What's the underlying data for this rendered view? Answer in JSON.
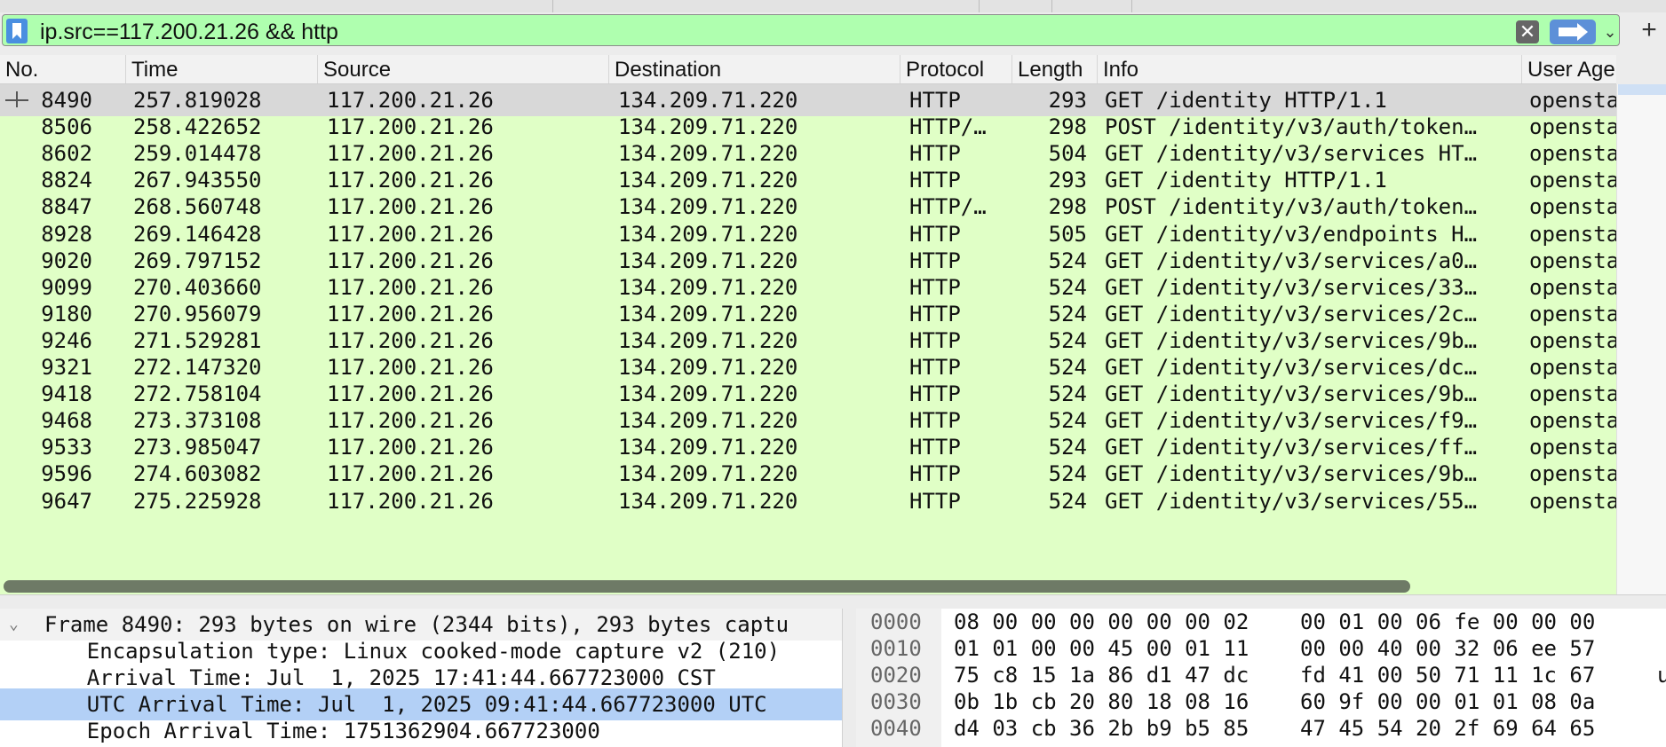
{
  "filter": {
    "value": "ip.src==117.200.21.26 && http",
    "clear_glyph": "✕",
    "dropdown_glyph": "⌄",
    "add_glyph": "+"
  },
  "columns": {
    "no": "No.",
    "time": "Time",
    "source": "Source",
    "destination": "Destination",
    "protocol": "Protocol",
    "length": "Length",
    "info": "Info",
    "user_agent": "User Age"
  },
  "packets": [
    {
      "no": "8490",
      "time": "257.819028",
      "src": "117.200.21.26",
      "dst": "134.209.71.220",
      "proto": "HTTP",
      "len": "293",
      "info": "GET /identity HTTP/1.1",
      "ua": "opensta"
    },
    {
      "no": "8506",
      "time": "258.422652",
      "src": "117.200.21.26",
      "dst": "134.209.71.220",
      "proto": "HTTP/…",
      "len": "298",
      "info": "POST /identity/v3/auth/token…",
      "ua": "opensta"
    },
    {
      "no": "8602",
      "time": "259.014478",
      "src": "117.200.21.26",
      "dst": "134.209.71.220",
      "proto": "HTTP",
      "len": "504",
      "info": "GET /identity/v3/services HT…",
      "ua": "opensta"
    },
    {
      "no": "8824",
      "time": "267.943550",
      "src": "117.200.21.26",
      "dst": "134.209.71.220",
      "proto": "HTTP",
      "len": "293",
      "info": "GET /identity HTTP/1.1",
      "ua": "opensta"
    },
    {
      "no": "8847",
      "time": "268.560748",
      "src": "117.200.21.26",
      "dst": "134.209.71.220",
      "proto": "HTTP/…",
      "len": "298",
      "info": "POST /identity/v3/auth/token…",
      "ua": "opensta"
    },
    {
      "no": "8928",
      "time": "269.146428",
      "src": "117.200.21.26",
      "dst": "134.209.71.220",
      "proto": "HTTP",
      "len": "505",
      "info": "GET /identity/v3/endpoints H…",
      "ua": "opensta"
    },
    {
      "no": "9020",
      "time": "269.797152",
      "src": "117.200.21.26",
      "dst": "134.209.71.220",
      "proto": "HTTP",
      "len": "524",
      "info": "GET /identity/v3/services/a0…",
      "ua": "opensta"
    },
    {
      "no": "9099",
      "time": "270.403660",
      "src": "117.200.21.26",
      "dst": "134.209.71.220",
      "proto": "HTTP",
      "len": "524",
      "info": "GET /identity/v3/services/33…",
      "ua": "opensta"
    },
    {
      "no": "9180",
      "time": "270.956079",
      "src": "117.200.21.26",
      "dst": "134.209.71.220",
      "proto": "HTTP",
      "len": "524",
      "info": "GET /identity/v3/services/2c…",
      "ua": "opensta"
    },
    {
      "no": "9246",
      "time": "271.529281",
      "src": "117.200.21.26",
      "dst": "134.209.71.220",
      "proto": "HTTP",
      "len": "524",
      "info": "GET /identity/v3/services/9b…",
      "ua": "opensta"
    },
    {
      "no": "9321",
      "time": "272.147320",
      "src": "117.200.21.26",
      "dst": "134.209.71.220",
      "proto": "HTTP",
      "len": "524",
      "info": "GET /identity/v3/services/dc…",
      "ua": "opensta"
    },
    {
      "no": "9418",
      "time": "272.758104",
      "src": "117.200.21.26",
      "dst": "134.209.71.220",
      "proto": "HTTP",
      "len": "524",
      "info": "GET /identity/v3/services/9b…",
      "ua": "opensta"
    },
    {
      "no": "9468",
      "time": "273.373108",
      "src": "117.200.21.26",
      "dst": "134.209.71.220",
      "proto": "HTTP",
      "len": "524",
      "info": "GET /identity/v3/services/f9…",
      "ua": "opensta"
    },
    {
      "no": "9533",
      "time": "273.985047",
      "src": "117.200.21.26",
      "dst": "134.209.71.220",
      "proto": "HTTP",
      "len": "524",
      "info": "GET /identity/v3/services/ff…",
      "ua": "opensta"
    },
    {
      "no": "9596",
      "time": "274.603082",
      "src": "117.200.21.26",
      "dst": "134.209.71.220",
      "proto": "HTTP",
      "len": "524",
      "info": "GET /identity/v3/services/9b…",
      "ua": "opensta"
    },
    {
      "no": "9647",
      "time": "275.225928",
      "src": "117.200.21.26",
      "dst": "134.209.71.220",
      "proto": "HTTP",
      "len": "524",
      "info": "GET /identity/v3/services/55…",
      "ua": "opensta"
    }
  ],
  "details": {
    "chevron": "⌄",
    "lines": [
      "Frame 8490: 293 bytes on wire (2344 bits), 293 bytes captu",
      "    Encapsulation type: Linux cooked-mode capture v2 (210)",
      "    Arrival Time: Jul  1, 2025 17:41:44.667723000 CST",
      "    UTC Arrival Time: Jul  1, 2025 09:41:44.667723000 UTC",
      "    Epoch Arrival Time: 1751362904.667723000"
    ]
  },
  "bytes": [
    {
      "off": "0000",
      "hex1": "08 00 00 00 00 00 00 02",
      "hex2": "00 01 00 06 fe 00 00 00",
      "asc": ""
    },
    {
      "off": "0010",
      "hex1": "01 01 00 00 45 00 01 11",
      "hex2": "00 00 40 00 32 06 ee 57",
      "asc": ""
    },
    {
      "off": "0020",
      "hex1": "75 c8 15 1a 86 d1 47 dc",
      "hex2": "fd 41 00 50 71 11 1c 67",
      "asc": "u"
    },
    {
      "off": "0030",
      "hex1": "0b 1b cb 20 80 18 08 16",
      "hex2": "60 9f 00 00 01 01 08 0a",
      "asc": ""
    },
    {
      "off": "0040",
      "hex1": "d4 03 cb 36 2b b9 b5 85",
      "hex2": "47 45 54 20 2f 69 64 65",
      "asc": ""
    }
  ],
  "colors": {
    "filter_valid": "#afffaf",
    "row_http": "#e0ffc6",
    "row_selected": "#d8d8d8",
    "detail_highlight": "#b3d0f6"
  }
}
